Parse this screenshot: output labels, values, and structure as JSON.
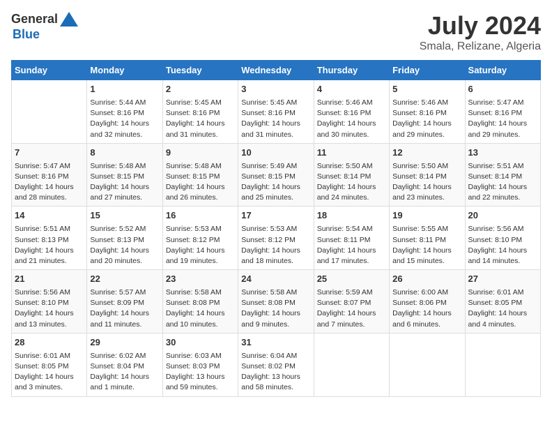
{
  "logo": {
    "general": "General",
    "blue": "Blue"
  },
  "title": "July 2024",
  "location": "Smala, Relizane, Algeria",
  "days_of_week": [
    "Sunday",
    "Monday",
    "Tuesday",
    "Wednesday",
    "Thursday",
    "Friday",
    "Saturday"
  ],
  "weeks": [
    [
      {
        "day": "",
        "info": ""
      },
      {
        "day": "1",
        "info": "Sunrise: 5:44 AM\nSunset: 8:16 PM\nDaylight: 14 hours\nand 32 minutes."
      },
      {
        "day": "2",
        "info": "Sunrise: 5:45 AM\nSunset: 8:16 PM\nDaylight: 14 hours\nand 31 minutes."
      },
      {
        "day": "3",
        "info": "Sunrise: 5:45 AM\nSunset: 8:16 PM\nDaylight: 14 hours\nand 31 minutes."
      },
      {
        "day": "4",
        "info": "Sunrise: 5:46 AM\nSunset: 8:16 PM\nDaylight: 14 hours\nand 30 minutes."
      },
      {
        "day": "5",
        "info": "Sunrise: 5:46 AM\nSunset: 8:16 PM\nDaylight: 14 hours\nand 29 minutes."
      },
      {
        "day": "6",
        "info": "Sunrise: 5:47 AM\nSunset: 8:16 PM\nDaylight: 14 hours\nand 29 minutes."
      }
    ],
    [
      {
        "day": "7",
        "info": "Sunrise: 5:47 AM\nSunset: 8:16 PM\nDaylight: 14 hours\nand 28 minutes."
      },
      {
        "day": "8",
        "info": "Sunrise: 5:48 AM\nSunset: 8:15 PM\nDaylight: 14 hours\nand 27 minutes."
      },
      {
        "day": "9",
        "info": "Sunrise: 5:48 AM\nSunset: 8:15 PM\nDaylight: 14 hours\nand 26 minutes."
      },
      {
        "day": "10",
        "info": "Sunrise: 5:49 AM\nSunset: 8:15 PM\nDaylight: 14 hours\nand 25 minutes."
      },
      {
        "day": "11",
        "info": "Sunrise: 5:50 AM\nSunset: 8:14 PM\nDaylight: 14 hours\nand 24 minutes."
      },
      {
        "day": "12",
        "info": "Sunrise: 5:50 AM\nSunset: 8:14 PM\nDaylight: 14 hours\nand 23 minutes."
      },
      {
        "day": "13",
        "info": "Sunrise: 5:51 AM\nSunset: 8:14 PM\nDaylight: 14 hours\nand 22 minutes."
      }
    ],
    [
      {
        "day": "14",
        "info": "Sunrise: 5:51 AM\nSunset: 8:13 PM\nDaylight: 14 hours\nand 21 minutes."
      },
      {
        "day": "15",
        "info": "Sunrise: 5:52 AM\nSunset: 8:13 PM\nDaylight: 14 hours\nand 20 minutes."
      },
      {
        "day": "16",
        "info": "Sunrise: 5:53 AM\nSunset: 8:12 PM\nDaylight: 14 hours\nand 19 minutes."
      },
      {
        "day": "17",
        "info": "Sunrise: 5:53 AM\nSunset: 8:12 PM\nDaylight: 14 hours\nand 18 minutes."
      },
      {
        "day": "18",
        "info": "Sunrise: 5:54 AM\nSunset: 8:11 PM\nDaylight: 14 hours\nand 17 minutes."
      },
      {
        "day": "19",
        "info": "Sunrise: 5:55 AM\nSunset: 8:11 PM\nDaylight: 14 hours\nand 15 minutes."
      },
      {
        "day": "20",
        "info": "Sunrise: 5:56 AM\nSunset: 8:10 PM\nDaylight: 14 hours\nand 14 minutes."
      }
    ],
    [
      {
        "day": "21",
        "info": "Sunrise: 5:56 AM\nSunset: 8:10 PM\nDaylight: 14 hours\nand 13 minutes."
      },
      {
        "day": "22",
        "info": "Sunrise: 5:57 AM\nSunset: 8:09 PM\nDaylight: 14 hours\nand 11 minutes."
      },
      {
        "day": "23",
        "info": "Sunrise: 5:58 AM\nSunset: 8:08 PM\nDaylight: 14 hours\nand 10 minutes."
      },
      {
        "day": "24",
        "info": "Sunrise: 5:58 AM\nSunset: 8:08 PM\nDaylight: 14 hours\nand 9 minutes."
      },
      {
        "day": "25",
        "info": "Sunrise: 5:59 AM\nSunset: 8:07 PM\nDaylight: 14 hours\nand 7 minutes."
      },
      {
        "day": "26",
        "info": "Sunrise: 6:00 AM\nSunset: 8:06 PM\nDaylight: 14 hours\nand 6 minutes."
      },
      {
        "day": "27",
        "info": "Sunrise: 6:01 AM\nSunset: 8:05 PM\nDaylight: 14 hours\nand 4 minutes."
      }
    ],
    [
      {
        "day": "28",
        "info": "Sunrise: 6:01 AM\nSunset: 8:05 PM\nDaylight: 14 hours\nand 3 minutes."
      },
      {
        "day": "29",
        "info": "Sunrise: 6:02 AM\nSunset: 8:04 PM\nDaylight: 14 hours\nand 1 minute."
      },
      {
        "day": "30",
        "info": "Sunrise: 6:03 AM\nSunset: 8:03 PM\nDaylight: 13 hours\nand 59 minutes."
      },
      {
        "day": "31",
        "info": "Sunrise: 6:04 AM\nSunset: 8:02 PM\nDaylight: 13 hours\nand 58 minutes."
      },
      {
        "day": "",
        "info": ""
      },
      {
        "day": "",
        "info": ""
      },
      {
        "day": "",
        "info": ""
      }
    ]
  ]
}
